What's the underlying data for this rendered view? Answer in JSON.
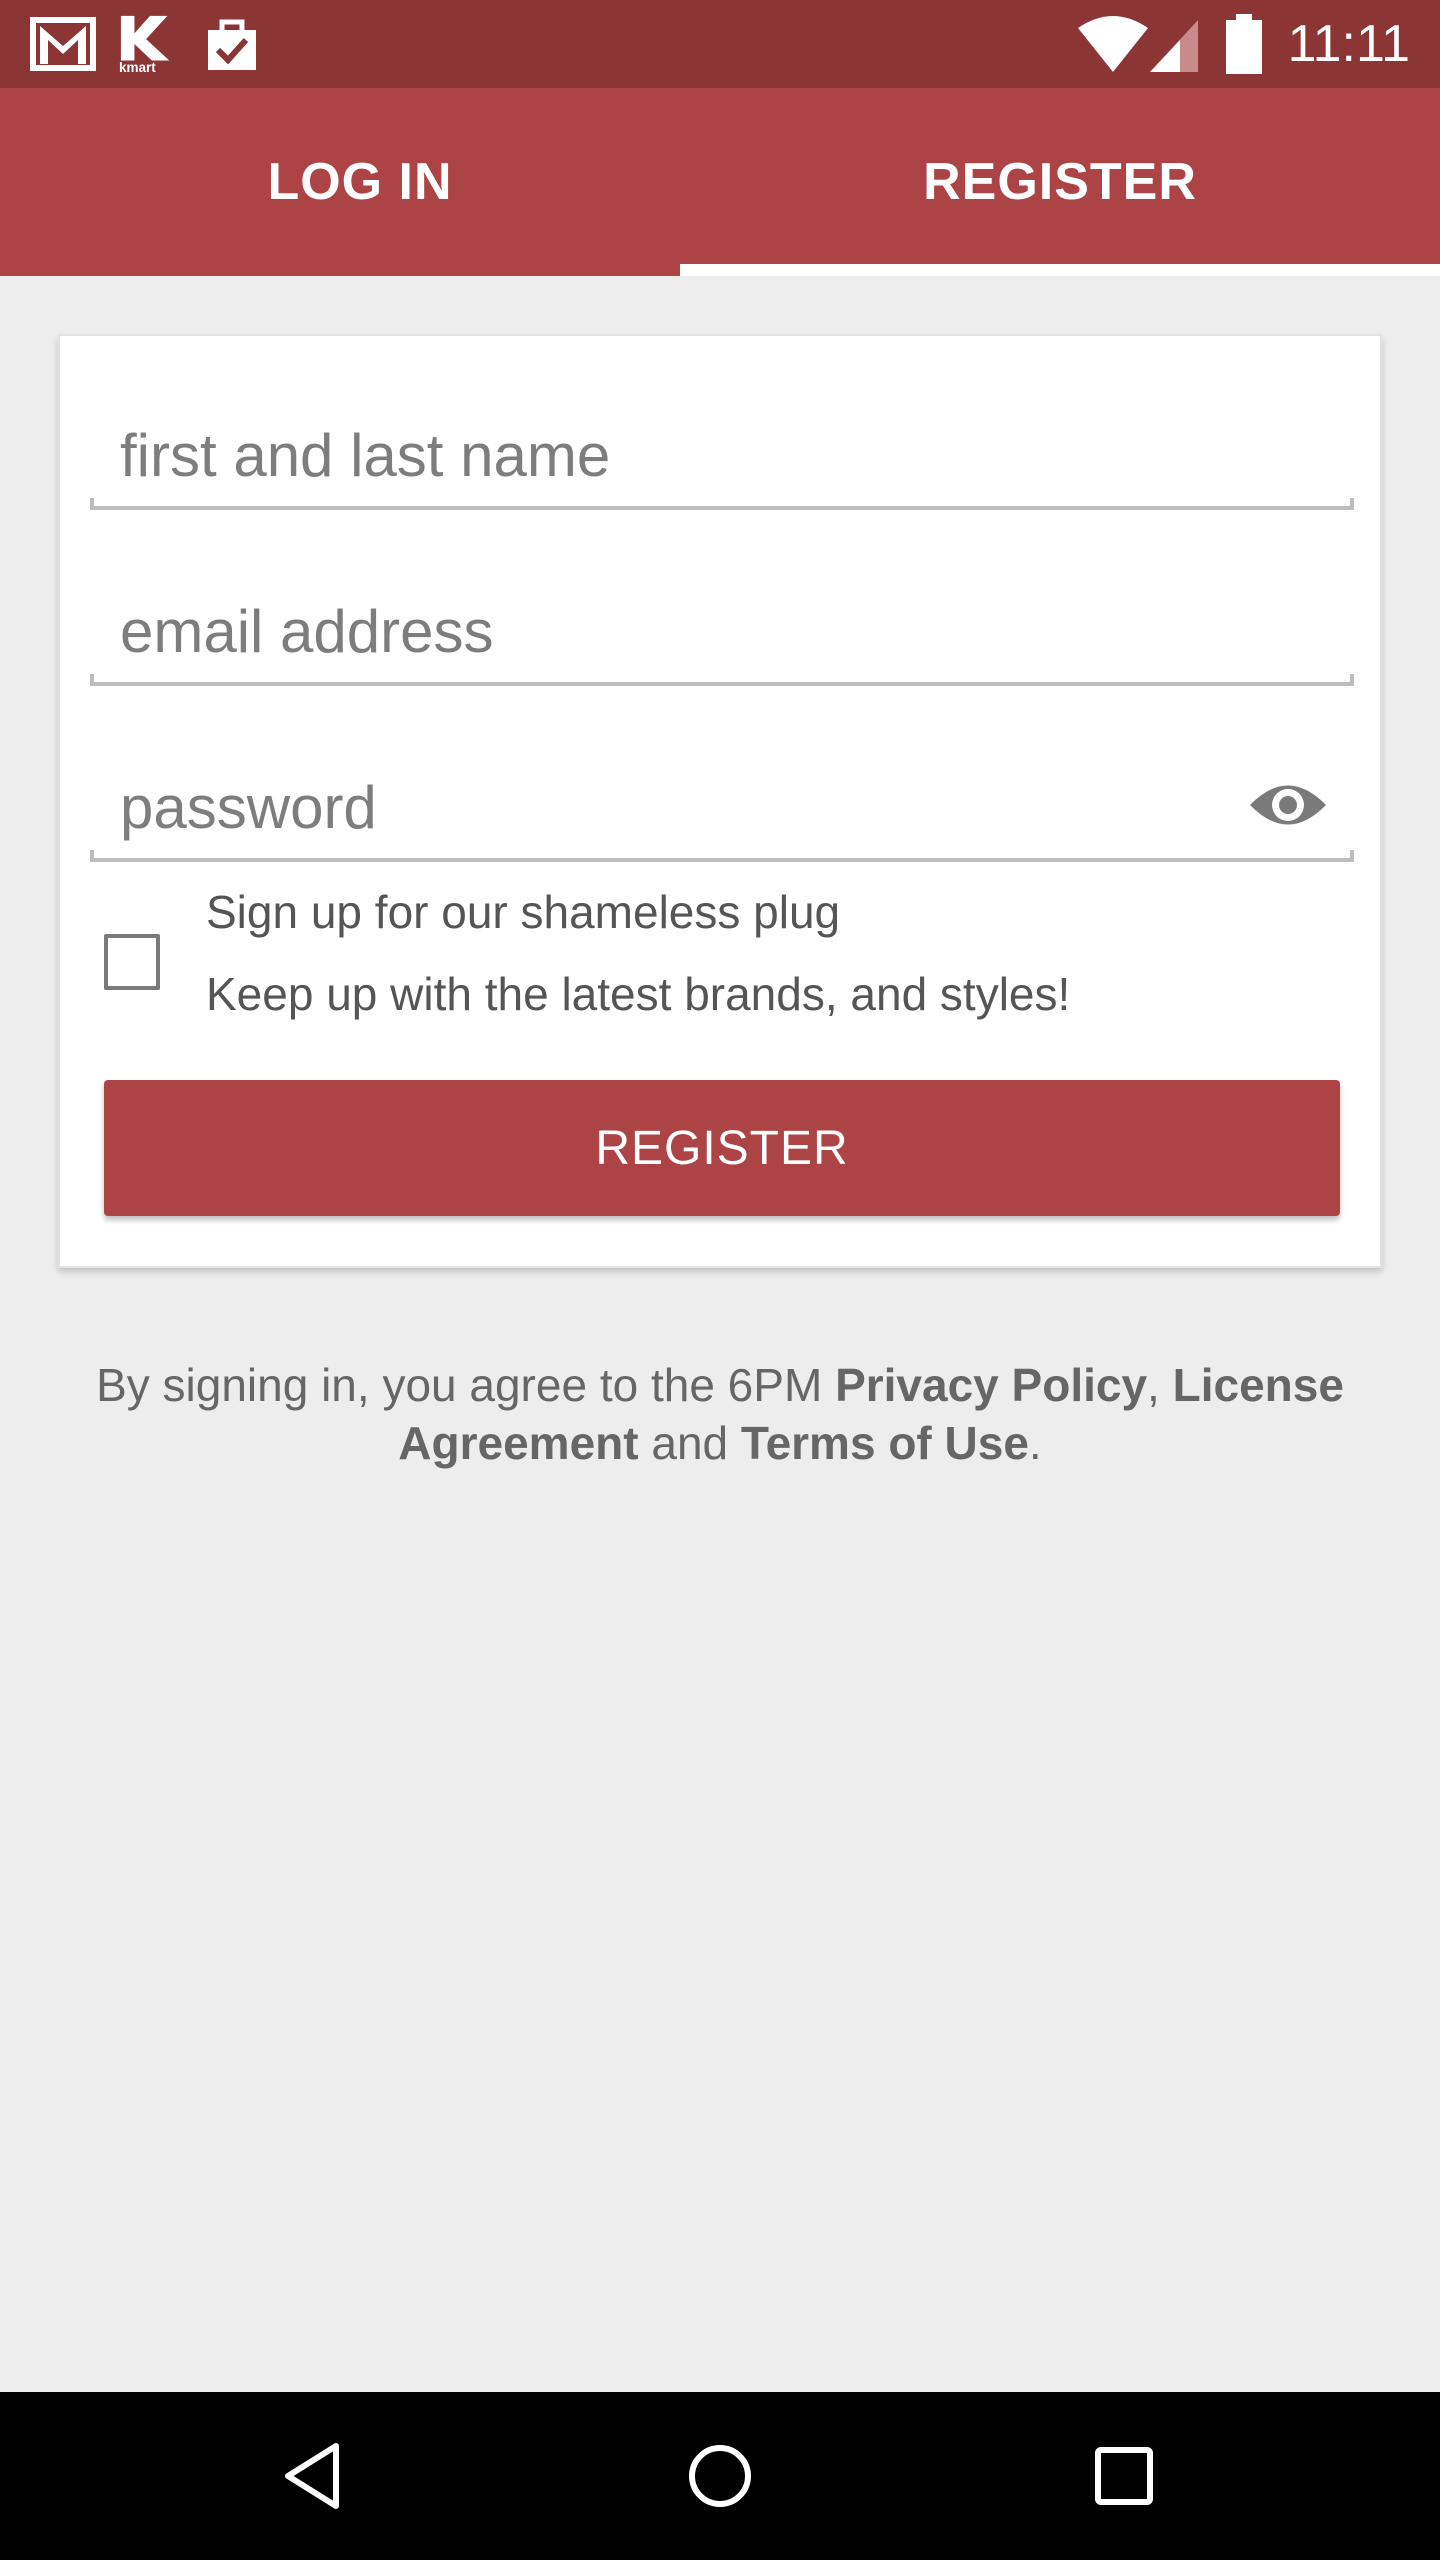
{
  "status_bar": {
    "time": "11:11",
    "icons": [
      "gmail-icon",
      "kmart-icon",
      "shopping-bag-icon",
      "wifi-icon",
      "signal-icon",
      "battery-icon"
    ],
    "kmart_text": "kmart"
  },
  "tabs": {
    "login": "LOG IN",
    "register": "REGISTER",
    "active": "register"
  },
  "form": {
    "name_placeholder": "first and last name",
    "email_placeholder": "email address",
    "password_placeholder": "password",
    "signup_title": "Sign up for our shameless plug",
    "signup_subtitle": "Keep up with the latest brands, and styles!",
    "register_button": "REGISTER"
  },
  "legal": {
    "prefix": "By signing in, you agree to the 6PM ",
    "privacy": "Privacy Policy",
    "comma": ", ",
    "license": "License Agreement",
    "and": " and ",
    "terms": "Terms of Use",
    "period": "."
  },
  "colors": {
    "status_bar": "#8b3535",
    "accent": "#ac4345",
    "background": "#ededed"
  }
}
